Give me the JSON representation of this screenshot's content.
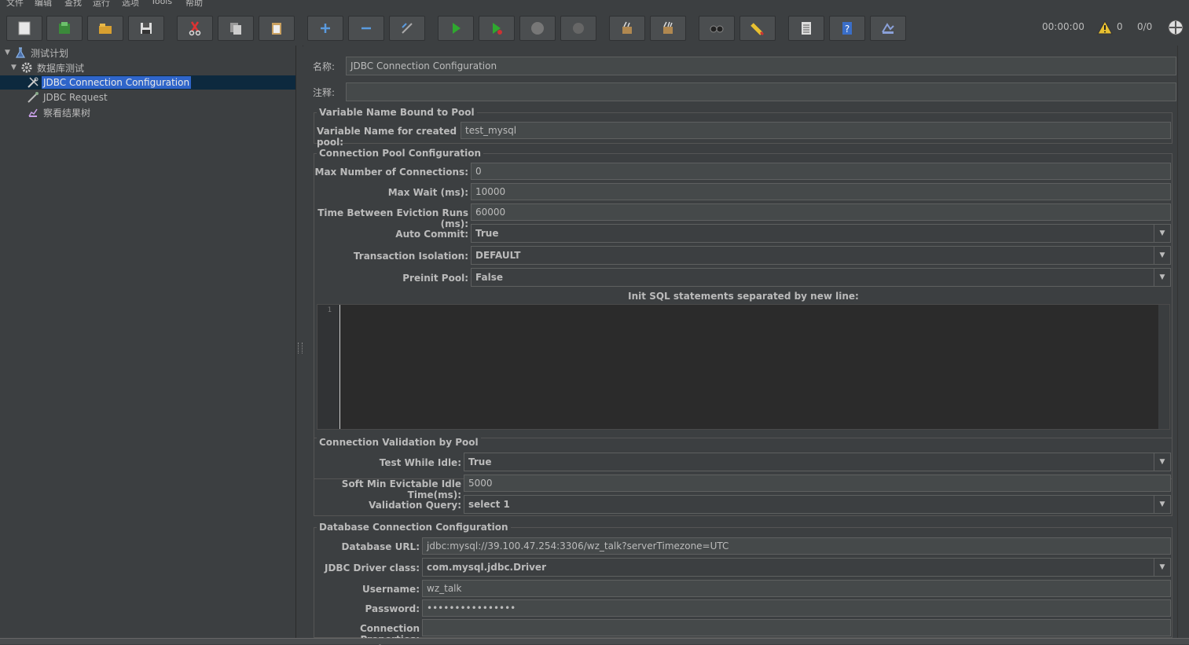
{
  "menu": [
    "文件",
    "编辑",
    "查找",
    "运行",
    "选项",
    "Tools",
    "帮助"
  ],
  "toolbar": {
    "buttons": [
      "new-icon",
      "templates-icon",
      "open-icon",
      "save-icon",
      "cut-icon",
      "copy-icon",
      "paste-icon",
      "expand-icon",
      "collapse-icon",
      "toggle-icon",
      "start-icon",
      "start-no-pause-icon",
      "stop-icon",
      "shutdown-icon",
      "clear-icon",
      "clear-all-icon",
      "search-icon",
      "reset-search-icon",
      "function-helper-icon",
      "help-icon",
      "remote-icon"
    ],
    "timer": "00:00:00",
    "warning_count": "0",
    "threads": "0/0"
  },
  "tree": {
    "root": "测试计划",
    "thread_group": "数据库测试",
    "children": [
      "JDBC Connection Configuration",
      "JDBC Request",
      "察看结果树"
    ]
  },
  "form": {
    "name_label": "名称:",
    "name_value": "JDBC Connection Configuration",
    "comment_label": "注释:",
    "comment_value": "",
    "var_section": {
      "title": "Variable Name Bound to Pool",
      "var_label": "Variable Name for created pool:",
      "var_value": "test_mysql"
    },
    "pool_section": {
      "title": "Connection Pool Configuration",
      "max_conn_label": "Max Number of Connections:",
      "max_conn_value": "0",
      "max_wait_label": "Max Wait (ms):",
      "max_wait_value": "10000",
      "eviction_label": "Time Between Eviction Runs (ms):",
      "eviction_value": "60000",
      "auto_commit_label": "Auto Commit:",
      "auto_commit_value": "True",
      "isolation_label": "Transaction Isolation:",
      "isolation_value": "DEFAULT",
      "preinit_label": "Preinit Pool:",
      "preinit_value": "False",
      "init_sql_label": "Init SQL statements separated by new line:",
      "line_number": "1"
    },
    "validation_section": {
      "title": "Connection Validation by Pool",
      "test_idle_label": "Test While Idle:",
      "test_idle_value": "True",
      "soft_min_label": "Soft Min Evictable Idle Time(ms):",
      "soft_min_value": "5000",
      "query_label": "Validation Query:",
      "query_value": "select 1"
    },
    "db_section": {
      "title": "Database Connection Configuration",
      "url_label": "Database URL:",
      "url_value": "jdbc:mysql://39.100.47.254:3306/wz_talk?serverTimezone=UTC",
      "driver_label": "JDBC Driver class:",
      "driver_value": "com.mysql.jdbc.Driver",
      "username_label": "Username:",
      "username_value": "wz_talk",
      "password_label": "Password:",
      "password_value": "••••••••••••••••",
      "props_label": "Connection Properties:",
      "props_value": ""
    }
  }
}
